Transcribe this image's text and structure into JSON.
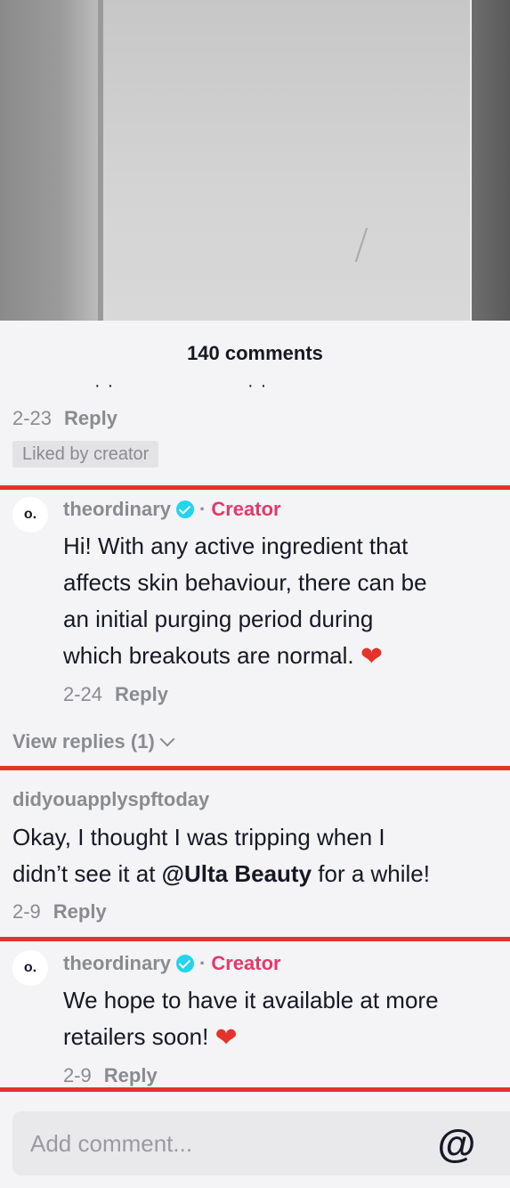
{
  "header": {
    "comment_count": "140 comments"
  },
  "comment_0": {
    "date": "2-23",
    "reply_label": "Reply",
    "badge": "Liked by creator"
  },
  "comment_1": {
    "avatar_text": "o.",
    "username": "theordinary",
    "creator_label": "Creator",
    "separator": "·",
    "lines": [
      "Hi! With any active ingredient that",
      "affects skin behaviour, there can be",
      "an initial purging period during",
      "which breakouts are normal."
    ],
    "emoji": "❤",
    "date": "2-24",
    "reply_label": "Reply",
    "view_replies": "View replies (1)"
  },
  "comment_2": {
    "username": "didyouapplyspftoday",
    "line1": "Okay, I thought I was tripping when I",
    "line2_pre": "didn’t see it at ",
    "mention": "@Ulta Beauty",
    "line2_post": " for a while!",
    "date": "2-9",
    "reply_label": "Reply"
  },
  "comment_3": {
    "avatar_text": "o.",
    "username": "theordinary",
    "creator_label": "Creator",
    "separator": "·",
    "line1": "We hope to have it available at more",
    "line2": "retailers soon!",
    "emoji": "❤",
    "date": "2-9",
    "reply_label": "Reply"
  },
  "input": {
    "placeholder": "Add comment...",
    "at_symbol": "@"
  },
  "colors": {
    "accent_red": "#e5332a",
    "creator_pink": "#e4396a",
    "verified_cyan": "#20d5ec"
  },
  "icons": [
    "verified-badge-icon",
    "heart-emoji-icon",
    "chevron-down-icon",
    "mention-at-icon"
  ]
}
